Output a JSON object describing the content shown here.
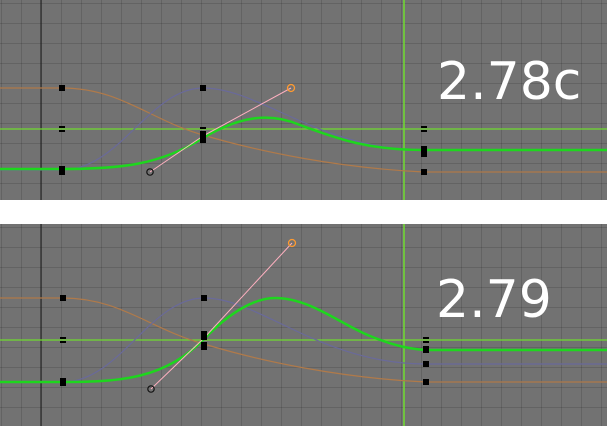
{
  "panels": [
    {
      "id": "top",
      "version_label": "2.78c"
    },
    {
      "id": "bottom",
      "version_label": "2.79"
    }
  ],
  "colors": {
    "background": "#727272",
    "grid": "#666666",
    "active_curve": "#1ed61e",
    "blue_curve": "#6a6a9a",
    "orange_curve": "#b07a4a",
    "handle_line": "#ffb0c0",
    "handle_point": "#ff9a30",
    "cursor_line": "#6fdc30",
    "text": "#ffffff"
  },
  "icons": [
    "keyframe-marker-icon",
    "handle-point-icon",
    "frame-cursor-icon"
  ]
}
